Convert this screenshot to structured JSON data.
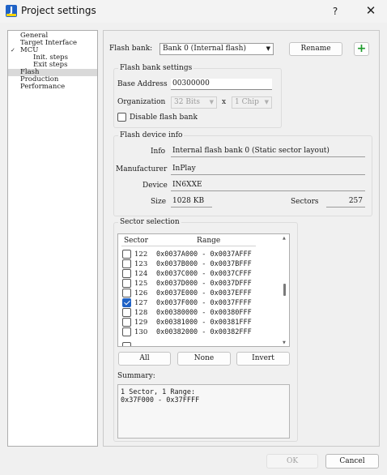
{
  "window": {
    "title": "Project settings",
    "help_label": "?",
    "close_label": "✕",
    "app_icon_letter": "J"
  },
  "nav": {
    "items": [
      {
        "label": "General",
        "level": 0
      },
      {
        "label": "Target Interface",
        "level": 0
      },
      {
        "label": "MCU",
        "level": 0,
        "expanded": true
      },
      {
        "label": "Init. steps",
        "level": 1
      },
      {
        "label": "Exit steps",
        "level": 1
      },
      {
        "label": "Flash",
        "level": 0,
        "selected": true
      },
      {
        "label": "Production",
        "level": 0
      },
      {
        "label": "Performance",
        "level": 0
      }
    ]
  },
  "flash_bank": {
    "label": "Flash bank:",
    "selected": "Bank 0 (Internal flash)",
    "rename_label": "Rename",
    "add_label": "+"
  },
  "bank_settings": {
    "title": "Flash bank settings",
    "base_address_label": "Base Address",
    "base_address_value": "00300000",
    "organization_label": "Organization",
    "organization_bits": "32 Bits",
    "organization_x": "x",
    "organization_chips": "1 Chip",
    "disable_label": "Disable flash bank",
    "disable_checked": false
  },
  "device_info": {
    "title": "Flash device info",
    "info_label": "Info",
    "info_value": "Internal flash bank 0 (Static sector layout)",
    "manufacturer_label": "Manufacturer",
    "manufacturer_value": "InPlay",
    "device_label": "Device",
    "device_value": "IN6XXE",
    "size_label": "Size",
    "size_value": "1028 KB",
    "sectors_label": "Sectors",
    "sectors_value": "257"
  },
  "sector_selection": {
    "title": "Sector selection",
    "columns": [
      "Sector",
      "Range"
    ],
    "rows": [
      {
        "sector": "122",
        "range": "0x0037A000 - 0x0037AFFF",
        "checked": false
      },
      {
        "sector": "123",
        "range": "0x0037B000 - 0x0037BFFF",
        "checked": false
      },
      {
        "sector": "124",
        "range": "0x0037C000 - 0x0037CFFF",
        "checked": false
      },
      {
        "sector": "125",
        "range": "0x0037D000 - 0x0037DFFF",
        "checked": false
      },
      {
        "sector": "126",
        "range": "0x0037E000 - 0x0037EFFF",
        "checked": false
      },
      {
        "sector": "127",
        "range": "0x0037F000 - 0x0037FFFF",
        "checked": true
      },
      {
        "sector": "128",
        "range": "0x00380000 - 0x00380FFF",
        "checked": false
      },
      {
        "sector": "129",
        "range": "0x00381000 - 0x00381FFF",
        "checked": false
      },
      {
        "sector": "130",
        "range": "0x00382000 - 0x00382FFF",
        "checked": false
      }
    ],
    "all_label": "All",
    "none_label": "None",
    "invert_label": "Invert",
    "summary_label": "Summary:",
    "summary_text": "1 Sector, 1 Range:\n0x37F000 - 0x37FFFF"
  },
  "footer": {
    "ok_label": "OK",
    "cancel_label": "Cancel"
  },
  "colors": {
    "accent": "#1f62c6",
    "add_green": "#1c9a2a",
    "selected_bg": "#d9d9d9"
  }
}
